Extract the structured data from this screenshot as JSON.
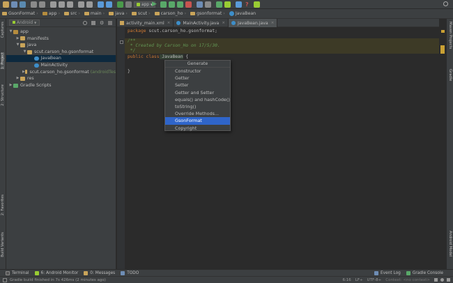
{
  "toolbar": {
    "run_config": "app"
  },
  "breadcrumb": [
    "GsonFormat",
    "app",
    "src",
    "main",
    "java",
    "scut",
    "carson_ho",
    "gsonformat",
    "JavaBean"
  ],
  "left_strip": {
    "captures": "Captures",
    "project": "1: Project",
    "structure": "2: Structure",
    "favorites": "2: Favorites",
    "build_variants": "Build Variants"
  },
  "right_strip": {
    "maven": "Maven Projects",
    "gradle": "Gradle",
    "android_model": "Android Model"
  },
  "project_panel": {
    "view_selector": "Android",
    "tree": [
      {
        "label": "app",
        "level": 0,
        "arrow": "▼",
        "icon": "module-folder-icon"
      },
      {
        "label": "manifests",
        "level": 1,
        "arrow": "▶",
        "icon": "folder-icon"
      },
      {
        "label": "java",
        "level": 1,
        "arrow": "▼",
        "icon": "folder-icon"
      },
      {
        "label": "scut.carson_ho.gsonformat",
        "level": 2,
        "arrow": "▼",
        "icon": "package-icon"
      },
      {
        "label": "JavaBean",
        "level": 3,
        "arrow": "",
        "icon": "class-icon",
        "selected": true
      },
      {
        "label": "MainActivity",
        "level": 3,
        "arrow": "",
        "icon": "class-icon"
      },
      {
        "label": "scut.carson_ho.gsonformat",
        "suffix": "(androidTes",
        "level": 2,
        "arrow": "▶",
        "icon": "package-icon"
      },
      {
        "label": "res",
        "level": 1,
        "arrow": "▶",
        "icon": "folder-icon"
      },
      {
        "label": "Gradle Scripts",
        "level": 0,
        "arrow": "▶",
        "icon": "gradle-icon"
      }
    ]
  },
  "editor_tabs": [
    {
      "label": "activity_main.xml",
      "active": false
    },
    {
      "label": "MainActivity.java",
      "active": false
    },
    {
      "label": "JavaBean.java",
      "active": true
    }
  ],
  "code": {
    "line_package_kw": "package",
    "line_package_name": " scut.carson_ho.gsonformat;",
    "doc_open": "/**",
    "doc_body": " * Created by Carson_Ho on 17/5/30.",
    "doc_close": " */",
    "class_kw": "public class",
    "class_name": " JavaBean",
    "class_brace": " {",
    "close_brace": "}"
  },
  "generate_popup": {
    "title": "Generate",
    "items": [
      "Constructor",
      "Getter",
      "Setter",
      "Getter and Setter",
      "equals() and hashCode()",
      "toString()",
      "Override Methods...",
      "GsonFormat",
      "Copyright"
    ],
    "selected_index": 7
  },
  "bottom_tools": [
    {
      "label": "Terminal",
      "icon": "terminal-icon"
    },
    {
      "label": "6: Android Monitor",
      "icon": "android-icon"
    },
    {
      "label": "0: Messages",
      "icon": "messages-icon"
    },
    {
      "label": "TODO",
      "icon": "todo-icon"
    }
  ],
  "bottom_tools_right": [
    {
      "label": "Event Log",
      "icon": "event-log-icon"
    },
    {
      "label": "Gradle Console",
      "icon": "gradle-console-icon"
    }
  ],
  "status": {
    "message": "Gradle build finished in 7s 426ms (2 minutes ago)",
    "position": "6:16",
    "line_sep": "LF÷",
    "encoding": "UTF-8÷",
    "context": "Context: <no context>"
  },
  "colors": {
    "accent": "#2f65ca",
    "keyword": "#cc7832",
    "doc_comment": "#629755"
  }
}
